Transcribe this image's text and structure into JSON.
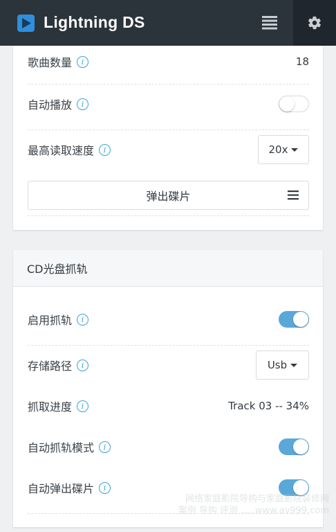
{
  "header": {
    "app_title": "Lightning DS",
    "logo_icon": "play-icon",
    "menu_icon": "list-icon",
    "settings_icon": "gear-icon"
  },
  "playback_card": {
    "song_count": {
      "label": "歌曲数量",
      "value": "18"
    },
    "autoplay": {
      "label": "自动播放",
      "enabled": false
    },
    "max_read_speed": {
      "label": "最高读取速度",
      "selected": "20x"
    },
    "eject_button": "弹出碟片"
  },
  "rip_card": {
    "title": "CD光盘抓轨",
    "enable_rip": {
      "label": "启用抓轨",
      "enabled": true
    },
    "storage_path": {
      "label": "存储路径",
      "selected": "Usb"
    },
    "rip_progress": {
      "label": "抓取进度",
      "value": "Track 03 -- 34%"
    },
    "auto_rip_mode": {
      "label": "自动抓轨模式",
      "enabled": true
    },
    "auto_eject": {
      "label": "自动弹出碟片",
      "enabled": true
    }
  },
  "info_glyph": "i",
  "watermark": {
    "line1": "网络家庭影院导购与家庭影院装修网",
    "line2": "案例 导购 评测 .....www.av999.com"
  },
  "colors": {
    "topbar": "#2b333b",
    "accent": "#3aa1d8",
    "toggle_on": "#5aa8d8"
  }
}
